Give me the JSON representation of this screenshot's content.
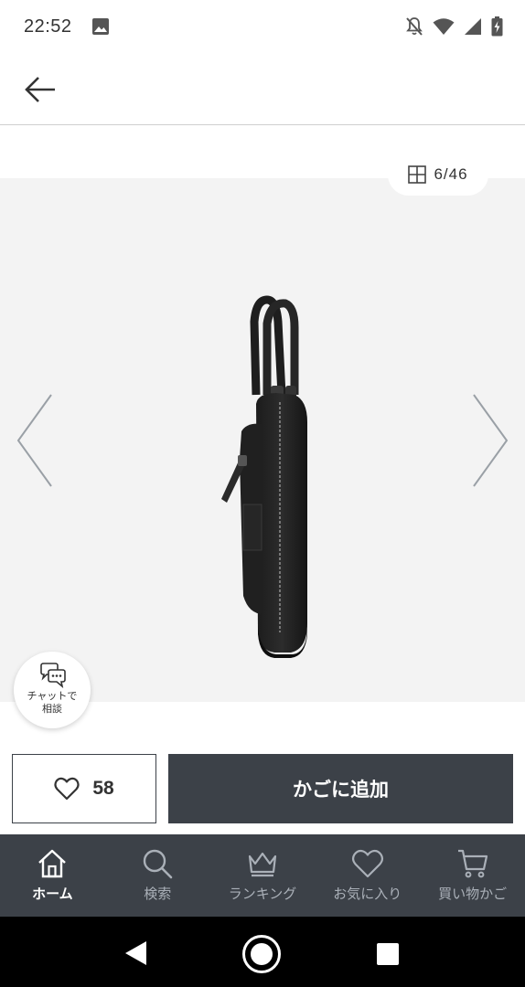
{
  "status_bar": {
    "time": "22:52",
    "icons": [
      "image-icon",
      "notifications-off-icon",
      "wifi-icon",
      "cellular-signal-icon",
      "battery-charging-icon"
    ]
  },
  "header": {
    "back_icon": "arrow-left-icon"
  },
  "gallery": {
    "counter_text": "6/46",
    "counter_icon": "grid-icon",
    "current_index": 6,
    "total_images": 46,
    "prev_icon": "chevron-left-icon",
    "next_icon": "chevron-right-icon",
    "background_color": "#f3f3f3"
  },
  "chat": {
    "label": "チャットで\n相談",
    "icon": "chat-bubbles-icon"
  },
  "actions": {
    "favorite_count": "58",
    "favorite_icon": "heart-outline-icon",
    "add_to_cart_label": "かごに追加",
    "primary_color": "#3c4148"
  },
  "bottom_nav": {
    "items": [
      {
        "label": "ホーム",
        "icon": "home-icon",
        "active": true
      },
      {
        "label": "検索",
        "icon": "search-icon",
        "active": false
      },
      {
        "label": "ランキング",
        "icon": "crown-icon",
        "active": false
      },
      {
        "label": "お気に入り",
        "icon": "heart-icon",
        "active": false
      },
      {
        "label": "買い物かご",
        "icon": "cart-icon",
        "active": false
      }
    ]
  },
  "system_nav": {
    "icons": [
      "back-triangle-icon",
      "home-circle-icon",
      "recents-square-icon"
    ]
  }
}
